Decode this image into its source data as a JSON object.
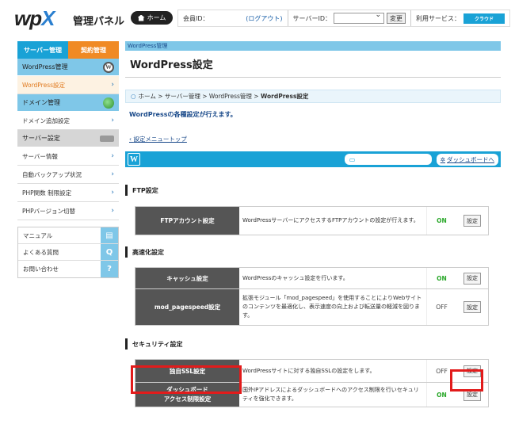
{
  "header": {
    "logo_main": "wp",
    "logo_x": "X",
    "app_title": "管理パネル",
    "home_label": "ホーム",
    "member_id_label": "会員ID：",
    "logout_label": "(ログアウト)",
    "server_id_label": "サーバーID：",
    "server_id_value": "",
    "change_label": "変更",
    "services_label": "利用サービス：",
    "service_badge": "クラウド"
  },
  "sidebar": {
    "tabs": [
      "サーバー管理",
      "契約管理"
    ],
    "groups": [
      {
        "label": "WordPress管理",
        "items": [
          "WordPress設定"
        ]
      },
      {
        "label": "ドメイン管理",
        "items": [
          "ドメイン追加設定"
        ]
      },
      {
        "label": "サーバー設定",
        "items": [
          "サーバー情報",
          "自動バックアップ状況",
          "PHP関数 制限設定",
          "PHPバージョン切替"
        ]
      }
    ],
    "help": [
      "マニュアル",
      "よくある質問",
      "お問い合わせ"
    ]
  },
  "main": {
    "top_crumb": "WordPress管理",
    "title": "WordPress設定",
    "breadcrumb": [
      "ホーム",
      "サーバー管理",
      "WordPress管理",
      "WordPress設定"
    ],
    "description": "WordPressの各種設定が行えます。",
    "back_link": "設定メニュートップ",
    "dashboard_label": "ダッシュボードへ",
    "sections": [
      {
        "title": "FTP設定",
        "rows": [
          {
            "name": "FTPアカウント設定",
            "desc": "WordPressサーバーにアクセスするFTPアカウントの設定が行えます。",
            "status": "ON",
            "button": "設定"
          }
        ]
      },
      {
        "title": "高速化設定",
        "rows": [
          {
            "name": "キャッシュ設定",
            "desc": "WordPressのキャッシュ設定を行います。",
            "status": "ON",
            "button": "設定"
          },
          {
            "name": "mod_pagespeed設定",
            "desc": "拡張モジュール「mod_pagespeed」を使用することによりWebサイトのコンテンツを最適化し、表示速度の向上および転送量の軽減を図ります。",
            "status": "OFF",
            "button": "設定"
          }
        ]
      },
      {
        "title": "セキュリティ設定",
        "rows": [
          {
            "name": "独自SSL設定",
            "desc": "WordPressサイトに対する独自SSLの設定をします。",
            "status": "OFF",
            "button": "設定"
          },
          {
            "name": "ダッシュボード\nアクセス制限設定",
            "desc": "国外IPアドレスによるダッシュボードへのアクセス制限を行いセキュリティを強化できます。",
            "status": "ON",
            "button": "設定"
          }
        ]
      }
    ]
  },
  "colors": {
    "accent": "#19a2d6",
    "sidebar_blue": "#7fc7e8",
    "tab_orange": "#f08a24",
    "highlight_red": "#e21b1b",
    "on_green": "#2aa82a"
  }
}
